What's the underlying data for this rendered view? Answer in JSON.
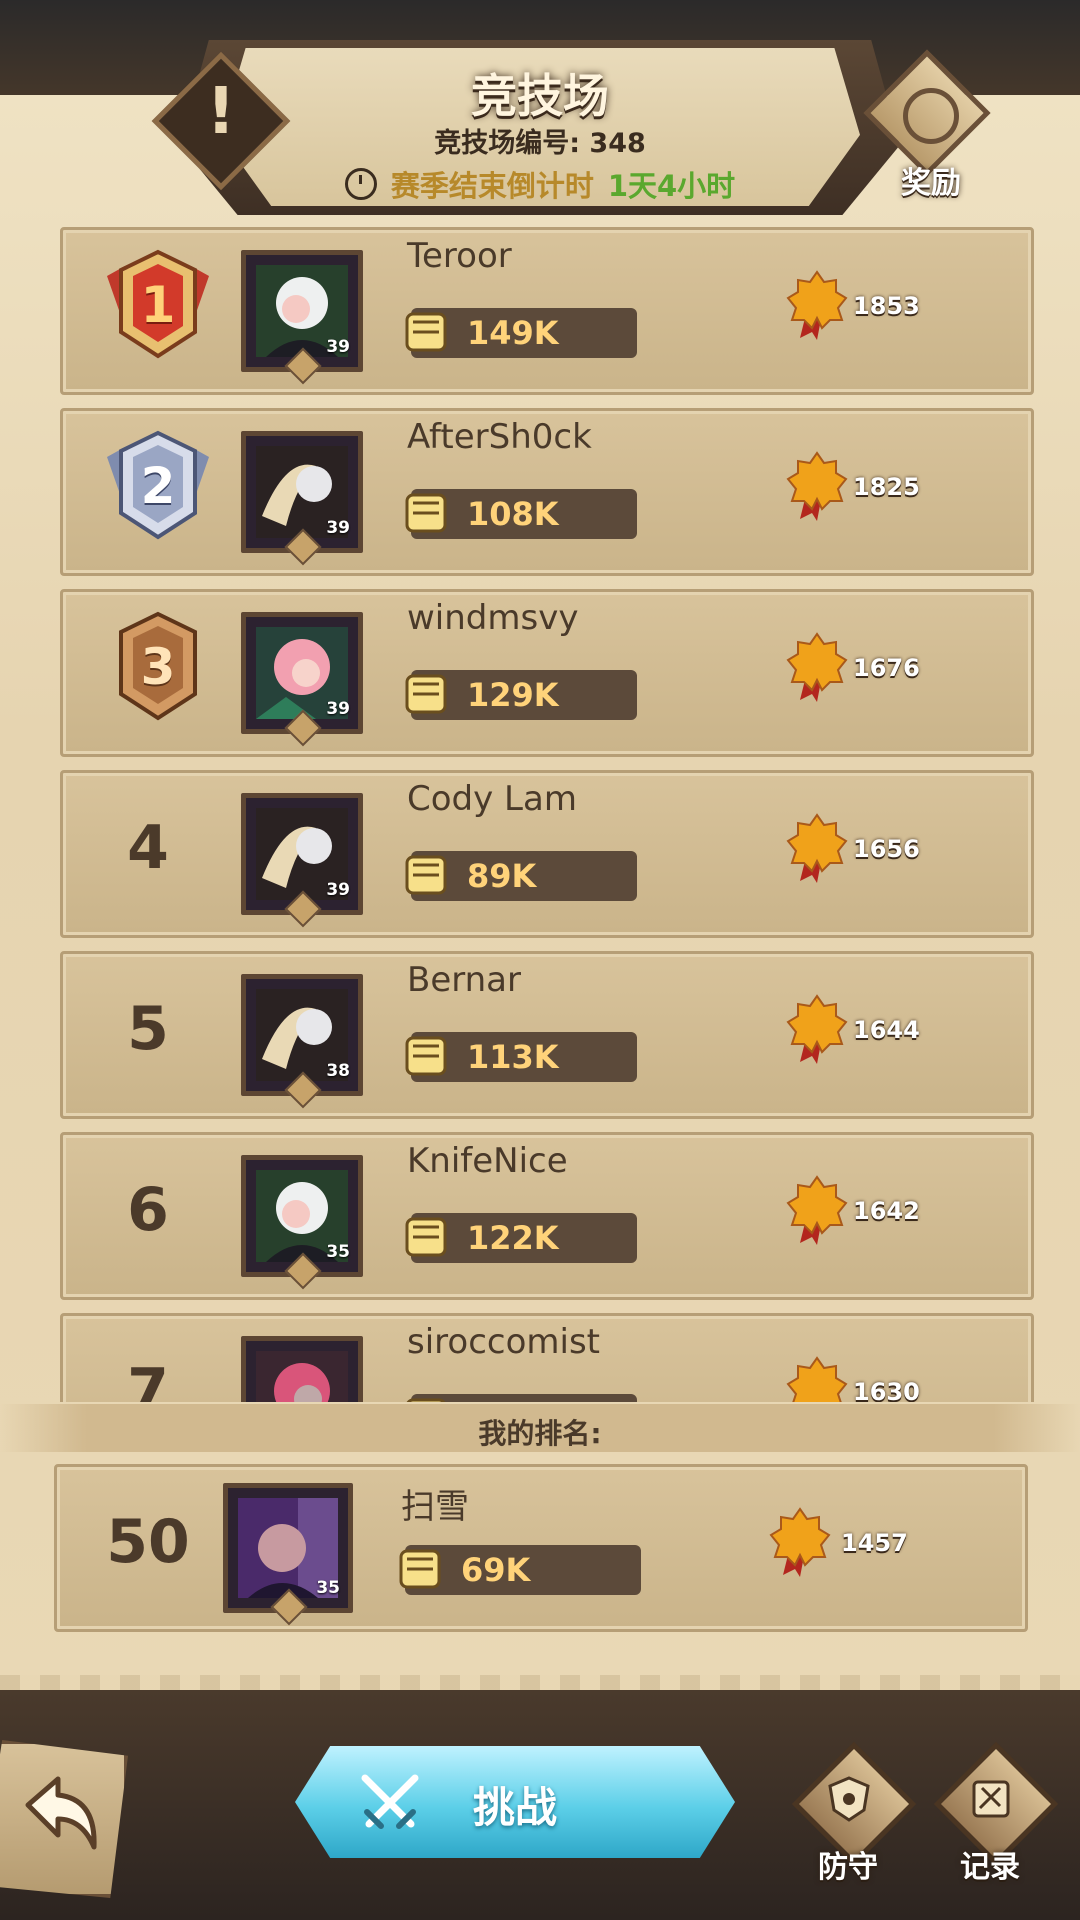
{
  "header": {
    "title": "竞技场",
    "arena_id": "竞技场编号: 348",
    "countdown_label": "赛季结束倒计时",
    "countdown_value": "1天4小时",
    "reward_label": "奖励"
  },
  "leaderboard": [
    {
      "rank": "1",
      "name": "Teroor",
      "level": "39",
      "power": "149K",
      "score": "1853"
    },
    {
      "rank": "2",
      "name": "AfterSh0ck",
      "level": "39",
      "power": "108K",
      "score": "1825"
    },
    {
      "rank": "3",
      "name": "windmsvy",
      "level": "39",
      "power": "129K",
      "score": "1676"
    },
    {
      "rank": "4",
      "name": "Cody Lam",
      "level": "39",
      "power": "89K",
      "score": "1656"
    },
    {
      "rank": "5",
      "name": "Bernar",
      "level": "38",
      "power": "113K",
      "score": "1644"
    },
    {
      "rank": "6",
      "name": "KnifeNice",
      "level": "35",
      "power": "122K",
      "score": "1642"
    },
    {
      "rank": "7",
      "name": "siroccomist",
      "level": "",
      "power": "",
      "score": "1630"
    }
  ],
  "my_rank": {
    "label": "我的排名:",
    "rank": "50",
    "name": "扫雪",
    "level": "35",
    "power": "69K",
    "score": "1457"
  },
  "bottom": {
    "challenge_label": "挑战",
    "defense_label": "防守",
    "records_label": "记录"
  },
  "colors": {
    "gold_badge": "#c0392b",
    "silver_badge": "#9aa6c4",
    "bronze_badge": "#a86b3c",
    "countdown_value": "#5aa82e",
    "challenge_button": "#5ccfe8"
  }
}
